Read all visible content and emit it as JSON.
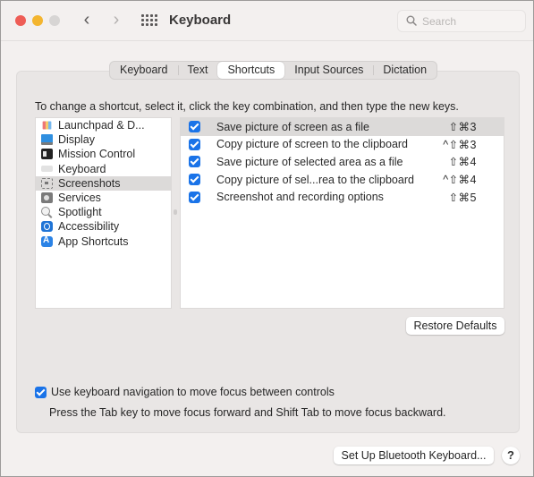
{
  "window": {
    "title": "Keyboard",
    "search_placeholder": "Search",
    "nav": {
      "back_icon": "chevron-left",
      "forward_icon": "chevron-right",
      "show_all_icon": "grid"
    }
  },
  "tabs": [
    {
      "label": "Keyboard",
      "active": false
    },
    {
      "label": "Text",
      "active": false
    },
    {
      "label": "Shortcuts",
      "active": true
    },
    {
      "label": "Input Sources",
      "active": false
    },
    {
      "label": "Dictation",
      "active": false
    }
  ],
  "instructions": "To change a shortcut, select it, click the key combination, and then type the new keys.",
  "categories": [
    {
      "label": "Launchpad & D...",
      "icon": "launchpad-icon"
    },
    {
      "label": "Display",
      "icon": "display-icon"
    },
    {
      "label": "Mission Control",
      "icon": "mission-control-icon"
    },
    {
      "label": "Keyboard",
      "icon": "keyboard-icon"
    },
    {
      "label": "Screenshots",
      "icon": "screenshots-icon",
      "selected": true
    },
    {
      "label": "Services",
      "icon": "services-icon"
    },
    {
      "label": "Spotlight",
      "icon": "spotlight-icon"
    },
    {
      "label": "Accessibility",
      "icon": "accessibility-icon"
    },
    {
      "label": "App Shortcuts",
      "icon": "app-shortcuts-icon"
    }
  ],
  "shortcuts": [
    {
      "checked": true,
      "label": "Save picture of screen as a file",
      "keys": "⇧⌘3",
      "selected": true
    },
    {
      "checked": true,
      "label": "Copy picture of screen to the clipboard",
      "keys": "^⇧⌘3"
    },
    {
      "checked": true,
      "label": "Save picture of selected area as a file",
      "keys": "⇧⌘4"
    },
    {
      "checked": true,
      "label": "Copy picture of sel...rea to the clipboard",
      "keys": "^⇧⌘4"
    },
    {
      "checked": true,
      "label": "Screenshot and recording options",
      "keys": "⇧⌘5"
    }
  ],
  "restore_defaults": "Restore Defaults",
  "keyboard_navigation": {
    "checked": true,
    "label": "Use keyboard navigation to move focus between controls",
    "hint": "Press the Tab key to move focus forward and Shift Tab to move focus backward."
  },
  "bluetooth_button": "Set Up Bluetooth Keyboard...",
  "help_button": "?",
  "colors": {
    "accent": "#1a73e8",
    "selection": "#dcdad9",
    "close": "#ee5d56",
    "minimize": "#f3b52f"
  }
}
